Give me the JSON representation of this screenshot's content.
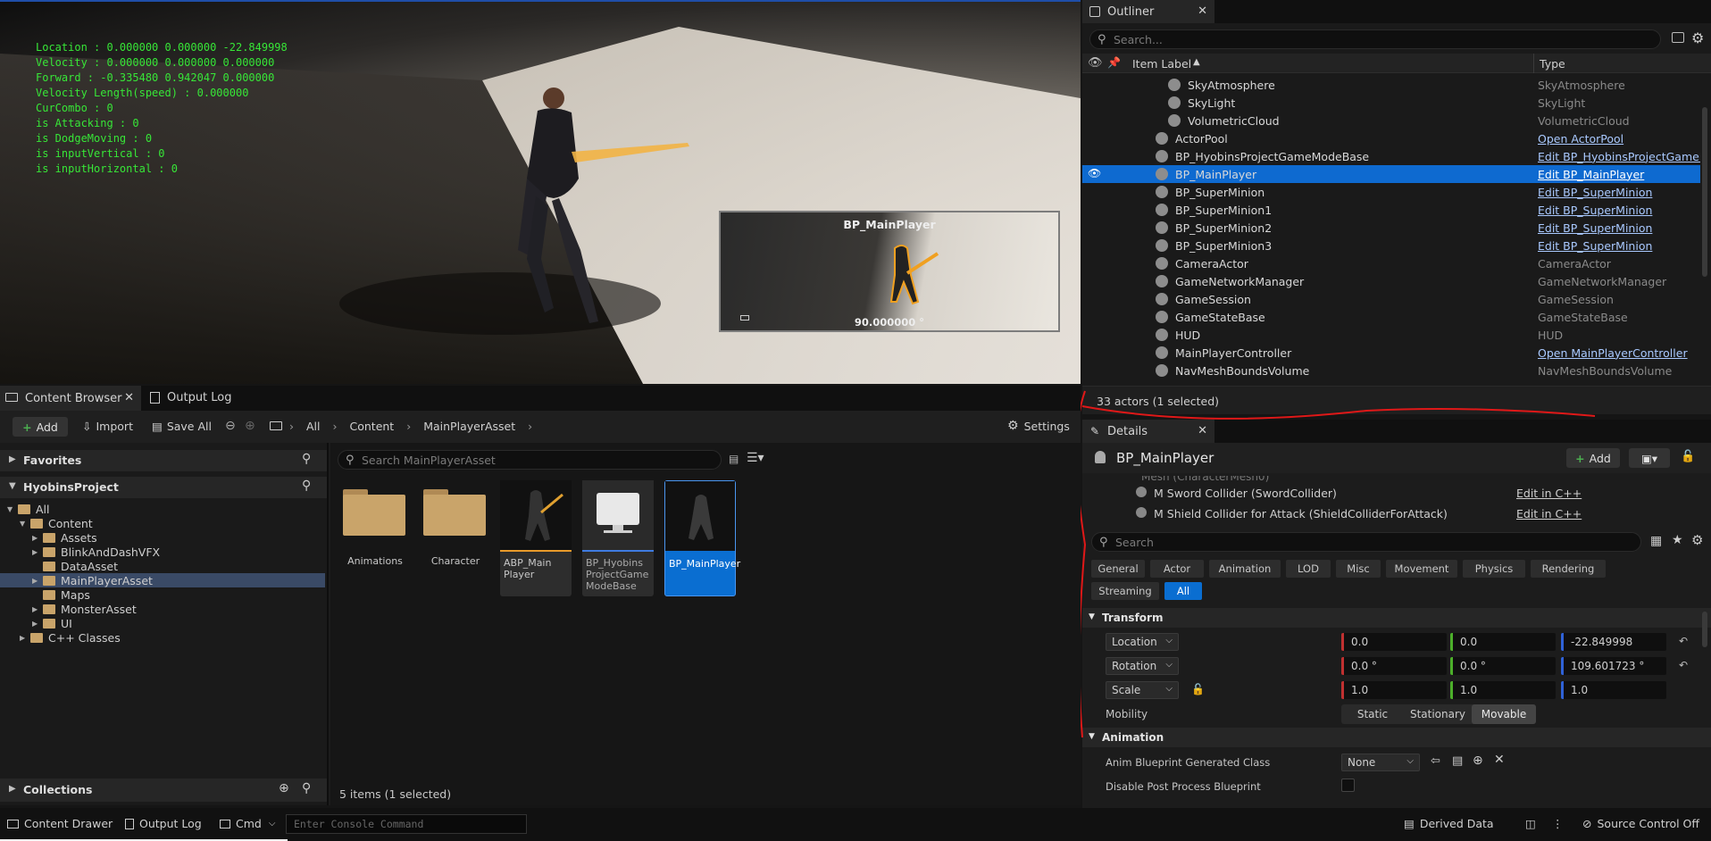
{
  "viewport": {
    "debug_lines": [
      "Location : 0.000000  0.000000  -22.849998",
      "Velocity : 0.000000  0.000000  0.000000",
      "Forward : -0.335480  0.942047  0.000000",
      "Velocity Length(speed) : 0.000000",
      "CurCombo : 0",
      "is Attacking : 0",
      "is DodgeMoving : 0",
      "is inputVertical : 0",
      "is inputHorizontal : 0"
    ],
    "preview": {
      "title": "BP_MainPlayer",
      "angle": "90.000000 °"
    }
  },
  "outliner": {
    "tab_label": "Outliner",
    "search_placeholder": "Search...",
    "col_label": "Item Label",
    "col_type": "Type",
    "rows": [
      {
        "label": "SkyAtmosphere",
        "type": "SkyAtmosphere",
        "link": false,
        "icon": "sky-atmosphere-icon",
        "indent": 1
      },
      {
        "label": "SkyLight",
        "type": "SkyLight",
        "link": false,
        "icon": "skylight-icon",
        "indent": 1
      },
      {
        "label": "VolumetricCloud",
        "type": "VolumetricCloud",
        "link": false,
        "icon": "cloud-icon",
        "indent": 1
      },
      {
        "label": "ActorPool",
        "type": "Open ActorPool",
        "link": true,
        "icon": "actor-icon",
        "indent": 0
      },
      {
        "label": "BP_HyobinsProjectGameModeBase",
        "type": "Edit BP_HyobinsProjectGameM",
        "link": true,
        "icon": "gamemode-icon",
        "indent": 0
      },
      {
        "label": "BP_MainPlayer",
        "type": "Edit BP_MainPlayer",
        "link": true,
        "icon": "pawn-icon",
        "indent": 0,
        "selected": true
      },
      {
        "label": "BP_SuperMinion",
        "type": "Edit BP_SuperMinion",
        "link": true,
        "icon": "pawn-icon",
        "indent": 0
      },
      {
        "label": "BP_SuperMinion1",
        "type": "Edit BP_SuperMinion",
        "link": true,
        "icon": "pawn-icon",
        "indent": 0
      },
      {
        "label": "BP_SuperMinion2",
        "type": "Edit BP_SuperMinion",
        "link": true,
        "icon": "pawn-icon",
        "indent": 0
      },
      {
        "label": "BP_SuperMinion3",
        "type": "Edit BP_SuperMinion",
        "link": true,
        "icon": "pawn-icon",
        "indent": 0
      },
      {
        "label": "CameraActor",
        "type": "CameraActor",
        "link": false,
        "icon": "camera-icon",
        "indent": 0
      },
      {
        "label": "GameNetworkManager",
        "type": "GameNetworkManager",
        "link": false,
        "icon": "actor-icon",
        "indent": 0
      },
      {
        "label": "GameSession",
        "type": "GameSession",
        "link": false,
        "icon": "actor-icon",
        "indent": 0
      },
      {
        "label": "GameStateBase",
        "type": "GameStateBase",
        "link": false,
        "icon": "gamestate-icon",
        "indent": 0
      },
      {
        "label": "HUD",
        "type": "HUD",
        "link": false,
        "icon": "hud-icon",
        "indent": 0
      },
      {
        "label": "MainPlayerController",
        "type": "Open MainPlayerController",
        "link": true,
        "icon": "controller-icon",
        "indent": 0
      },
      {
        "label": "NavMeshBoundsVolume",
        "type": "NavMeshBoundsVolume",
        "link": false,
        "icon": "volume-icon",
        "indent": 0
      }
    ],
    "status": "33 actors (1 selected)"
  },
  "details": {
    "tab_label": "Details",
    "actor_name": "BP_MainPlayer",
    "add_label": "Add",
    "components": [
      {
        "label": "M Sword Collider (SwordCollider)",
        "action": "Edit in C++"
      },
      {
        "label": "M Shield Collider for Attack (ShieldColliderForAttack)",
        "action": "Edit in C++"
      }
    ],
    "search_placeholder": "Search",
    "categories_row1": [
      "General",
      "Actor",
      "Animation",
      "LOD",
      "Misc",
      "Movement",
      "Physics",
      "Rendering"
    ],
    "categories_row2": [
      "Streaming",
      "All"
    ],
    "transform_label": "Transform",
    "location_label": "Location",
    "location": [
      "0.0",
      "0.0",
      "-22.849998"
    ],
    "rotation_label": "Rotation",
    "rotation": [
      "0.0 °",
      "0.0 °",
      "109.601723 °"
    ],
    "scale_label": "Scale",
    "scale": [
      "1.0",
      "1.0",
      "1.0"
    ],
    "mobility_label": "Mobility",
    "mobility_options": [
      "Static",
      "Stationary",
      "Movable"
    ],
    "animation_label": "Animation",
    "anim_bp_label": "Anim Blueprint Generated Class",
    "anim_bp_value": "None",
    "disable_pp_label": "Disable Post Process Blueprint"
  },
  "content_browser": {
    "tab_label": "Content Browser",
    "output_log_tab": "Output Log",
    "add_label": "Add",
    "import_label": "Import",
    "save_all_label": "Save All",
    "breadcrumb": [
      "All",
      "Content",
      "MainPlayerAsset"
    ],
    "settings_label": "Settings",
    "favorites_label": "Favorites",
    "project_label": "HyobinsProject",
    "tree": [
      {
        "label": "All",
        "indent": 0
      },
      {
        "label": "Content",
        "indent": 1
      },
      {
        "label": "Assets",
        "indent": 2
      },
      {
        "label": "BlinkAndDashVFX",
        "indent": 2
      },
      {
        "label": "DataAsset",
        "indent": 2
      },
      {
        "label": "MainPlayerAsset",
        "indent": 2,
        "selected": true
      },
      {
        "label": "Maps",
        "indent": 2
      },
      {
        "label": "MonsterAsset",
        "indent": 2
      },
      {
        "label": "UI",
        "indent": 2
      },
      {
        "label": "C++ Classes",
        "indent": 1
      }
    ],
    "collections_label": "Collections",
    "search_placeholder": "Search MainPlayerAsset",
    "folders": [
      "Animations",
      "Character"
    ],
    "assets": [
      {
        "name": "ABP_Main Player",
        "bar_color": "#e89a2a"
      },
      {
        "name": "BP_Hyobins ProjectGame ModeBase",
        "bar_color": "#3f7be0"
      },
      {
        "name": "BP_MainPlayer",
        "bar_color": "#3f7be0",
        "selected": true
      }
    ],
    "item_count": "5 items (1 selected)"
  },
  "statusbar": {
    "content_drawer": "Content Drawer",
    "output_log": "Output Log",
    "cmd": "Cmd",
    "console_placeholder": "Enter Console Command",
    "derived_data": "Derived Data",
    "source_control": "Source Control Off"
  }
}
